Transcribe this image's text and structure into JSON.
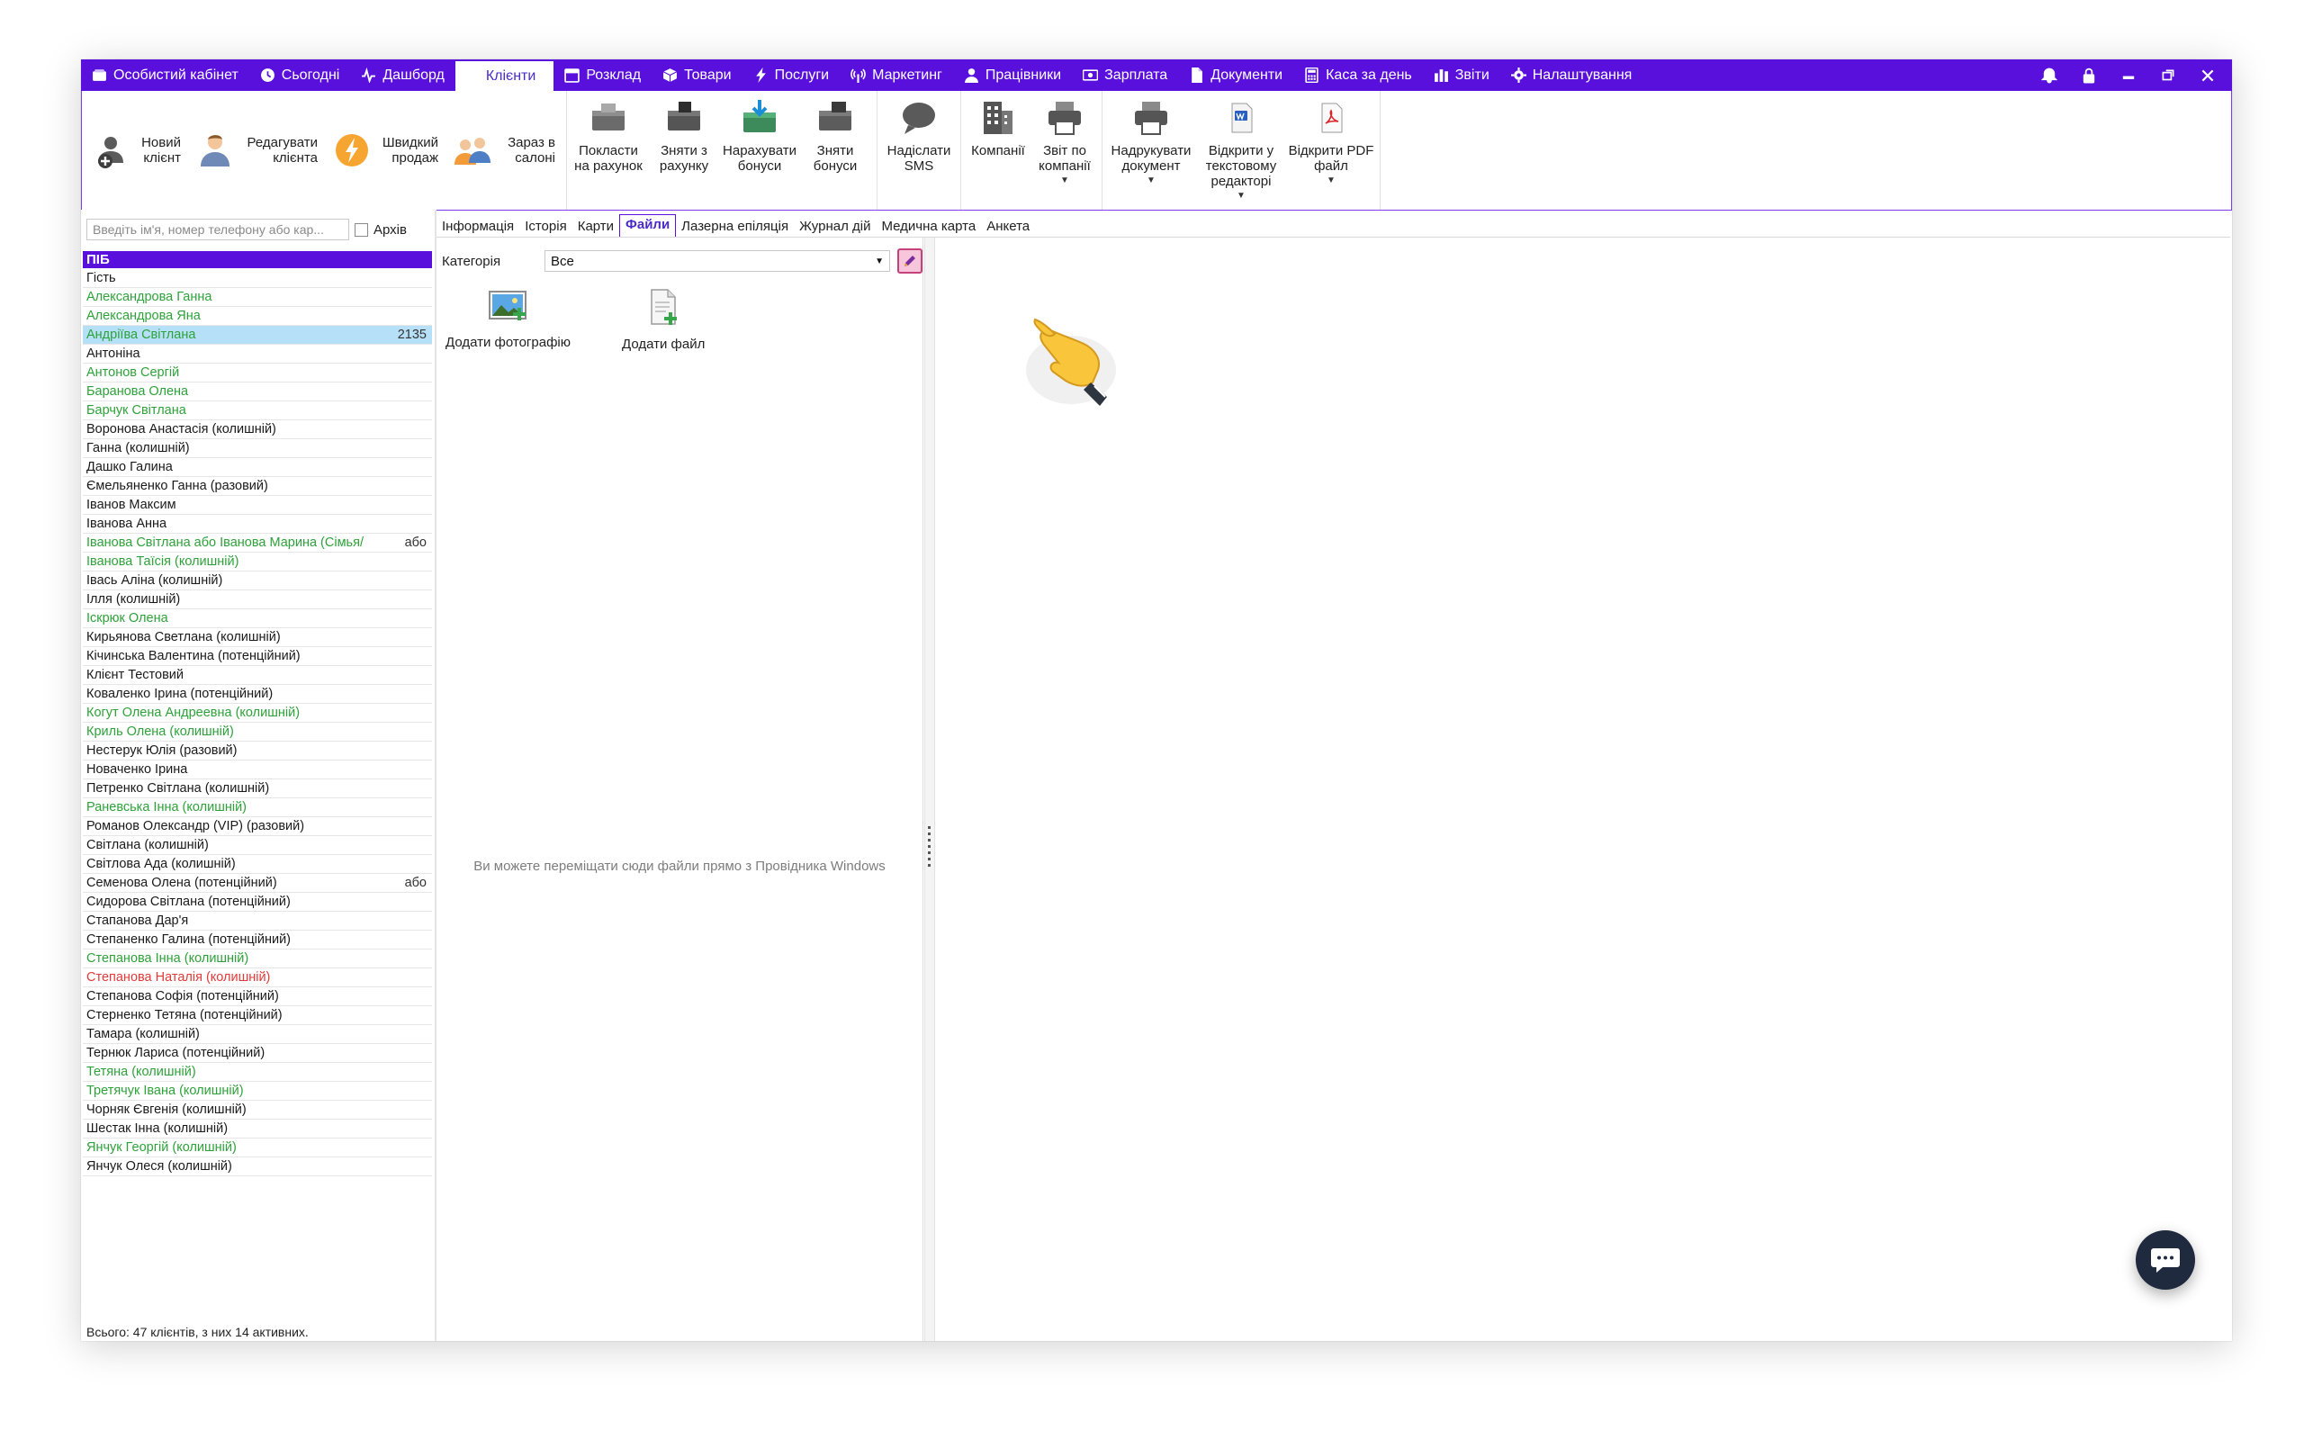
{
  "nav": {
    "items": [
      {
        "label": "Особистий кабінет",
        "icon": "wallet-icon"
      },
      {
        "label": "Сьогодні",
        "icon": "clock-icon"
      },
      {
        "label": "Дашборд",
        "icon": "pulse-icon"
      },
      {
        "label": "Клієнти",
        "icon": "",
        "active": true
      },
      {
        "label": "Розклад",
        "icon": "calendar-icon"
      },
      {
        "label": "Товари",
        "icon": "box-icon"
      },
      {
        "label": "Послуги",
        "icon": "bolt-icon"
      },
      {
        "label": "Маркетинг",
        "icon": "broadcast-icon"
      },
      {
        "label": "Працівники",
        "icon": "person-icon"
      },
      {
        "label": "Зарплата",
        "icon": "money-icon"
      },
      {
        "label": "Документи",
        "icon": "document-icon"
      },
      {
        "label": "Каса за день",
        "icon": "calculator-icon"
      },
      {
        "label": "Звіти",
        "icon": "bar-chart-icon"
      },
      {
        "label": "Налаштування",
        "icon": "gear-icon"
      }
    ]
  },
  "ribbon": {
    "new_client": "Новий клієнт",
    "edit_client": "Редагувати клієнта",
    "quick_sale": "Швидкий продаж",
    "in_salon": "Зараз в салоні",
    "put_on_account": "Покласти на рахунок",
    "withdraw_account": "Зняти з рахунку",
    "accrue_bonus": "Нарахувати бонуси",
    "withdraw_bonus": "Зняти бонуси",
    "send_sms": "Надіслати SMS",
    "companies": "Компанії",
    "company_report": "Звіт по компанії",
    "print_document": "Надрукувати документ",
    "open_text_editor": "Відкрити у текстовому редакторі",
    "open_pdf": "Відкрити PDF файл"
  },
  "left": {
    "search_placeholder": "Введіть ім'я, номер телефону або кар...",
    "archive_label": "Архів",
    "column_header": "ПІБ",
    "clients": [
      {
        "name": "Гість",
        "color": "black"
      },
      {
        "name": "Александрова Ганна",
        "color": "green"
      },
      {
        "name": "Александрова Яна",
        "color": "green"
      },
      {
        "name": "Андріїва Світлана",
        "color": "green",
        "extra": "2135",
        "selected": true
      },
      {
        "name": "Антоніна",
        "color": "black"
      },
      {
        "name": "Антонов Сергій",
        "color": "green"
      },
      {
        "name": "Баранова Олена",
        "color": "green"
      },
      {
        "name": "Барчук Світлана",
        "color": "green"
      },
      {
        "name": "Воронова Анастасія (колишній)",
        "color": "black"
      },
      {
        "name": "Ганна (колишній)",
        "color": "black"
      },
      {
        "name": "Дашко Галина",
        "color": "black"
      },
      {
        "name": "Ємельяненко Ганна (разовий)",
        "color": "black"
      },
      {
        "name": "Іванов Максим",
        "color": "black"
      },
      {
        "name": "Іванова Анна",
        "color": "black"
      },
      {
        "name": "Іванова Світлана або Іванова Марина (Сімья/",
        "color": "green",
        "extra": "або"
      },
      {
        "name": "Іванова Таїсія (колишній)",
        "color": "green"
      },
      {
        "name": "Івась Аліна (колишній)",
        "color": "black"
      },
      {
        "name": "Ілля (колишній)",
        "color": "black"
      },
      {
        "name": "Іскрюк Олена",
        "color": "green"
      },
      {
        "name": "Кирьянова Светлана (колишній)",
        "color": "black"
      },
      {
        "name": "Кічинська Валентина (потенційний)",
        "color": "black"
      },
      {
        "name": "Клієнт Тестовий",
        "color": "black"
      },
      {
        "name": "Коваленко Ірина (потенційний)",
        "color": "black"
      },
      {
        "name": "Когут Олена Андреевна (колишній)",
        "color": "green"
      },
      {
        "name": "Криль Олена (колишній)",
        "color": "green"
      },
      {
        "name": "Нестерук Юлія (разовий)",
        "color": "black"
      },
      {
        "name": "Новаченко Ірина",
        "color": "black"
      },
      {
        "name": "Петренко Світлана (колишній)",
        "color": "black"
      },
      {
        "name": "Раневська Інна (колишній)",
        "color": "green"
      },
      {
        "name": "Романов Олександр (VIP) (разовий)",
        "color": "black"
      },
      {
        "name": "Світлана (колишній)",
        "color": "black"
      },
      {
        "name": "Світлова Ада (колишній)",
        "color": "black"
      },
      {
        "name": "Семенова Олена (потенційний)",
        "color": "black",
        "extra": "або"
      },
      {
        "name": "Сидорова Світлана (потенційний)",
        "color": "black"
      },
      {
        "name": "Стапанова Дар'я",
        "color": "black"
      },
      {
        "name": "Степаненко Галина (потенційний)",
        "color": "black"
      },
      {
        "name": "Степанова Інна (колишній)",
        "color": "green"
      },
      {
        "name": "Степанова Наталія (колишній)",
        "color": "red"
      },
      {
        "name": "Степанова Софія (потенційний)",
        "color": "black"
      },
      {
        "name": "Стерненко Тетяна (потенційний)",
        "color": "black"
      },
      {
        "name": "Тамара (колишній)",
        "color": "black"
      },
      {
        "name": "Тернюк Лариса (потенційний)",
        "color": "black"
      },
      {
        "name": "Тетяна (колишній)",
        "color": "green"
      },
      {
        "name": "Третячук Івана (колишній)",
        "color": "green"
      },
      {
        "name": "Чорняк Євгенія (колишній)",
        "color": "black"
      },
      {
        "name": "Шестак Інна (колишній)",
        "color": "black"
      },
      {
        "name": "Янчук Георгій (колишній)",
        "color": "green"
      },
      {
        "name": "Янчук Олеся (колишній)",
        "color": "black"
      }
    ],
    "status": "Всього: 47 клієнтів, з них 14 активних."
  },
  "tabs": [
    {
      "label": "Інформація"
    },
    {
      "label": "Історія"
    },
    {
      "label": "Карти"
    },
    {
      "label": "Файли",
      "active": true
    },
    {
      "label": "Лазерна епіляція"
    },
    {
      "label": "Журнал дій"
    },
    {
      "label": "Медична карта"
    },
    {
      "label": "Анкета"
    }
  ],
  "files": {
    "category_label": "Категорія",
    "category_value": "Все",
    "add_photo": "Додати фотографію",
    "add_file": "Додати файл",
    "drop_hint": "Ви можете переміщати сюди файли прямо з Провідника Windows"
  },
  "colors": {
    "accent": "#5a10dc",
    "green_client": "#2ea23a",
    "red_client": "#e33a3a",
    "selected_row": "#b6e0f7"
  }
}
